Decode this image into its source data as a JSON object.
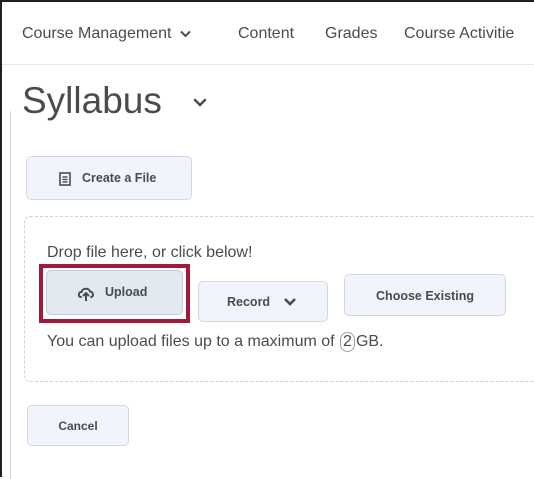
{
  "nav": {
    "items": [
      {
        "label": "Course Management",
        "has_dropdown": true
      },
      {
        "label": "Content",
        "has_dropdown": false
      },
      {
        "label": "Grades",
        "has_dropdown": false
      },
      {
        "label": "Course Activitie",
        "has_dropdown": false
      }
    ]
  },
  "page": {
    "title": "Syllabus"
  },
  "actions": {
    "create_file_label": "Create a File"
  },
  "dropzone": {
    "prompt": "Drop file here, or click below!",
    "upload_label": "Upload",
    "record_label": "Record",
    "choose_existing_label": "Choose Existing",
    "limit_prefix": "You can upload files up to a maximum of",
    "limit_value": "2",
    "limit_unit": "GB."
  },
  "footer": {
    "cancel_label": "Cancel"
  },
  "colors": {
    "text": "#494c4e",
    "button_bg": "#f1f5fb",
    "button_border": "#d3d9e3",
    "highlight": "#a1193b"
  },
  "icons": {
    "file": "file-icon",
    "upload": "cloud-upload-icon",
    "chevron": "chevron-down-icon"
  }
}
